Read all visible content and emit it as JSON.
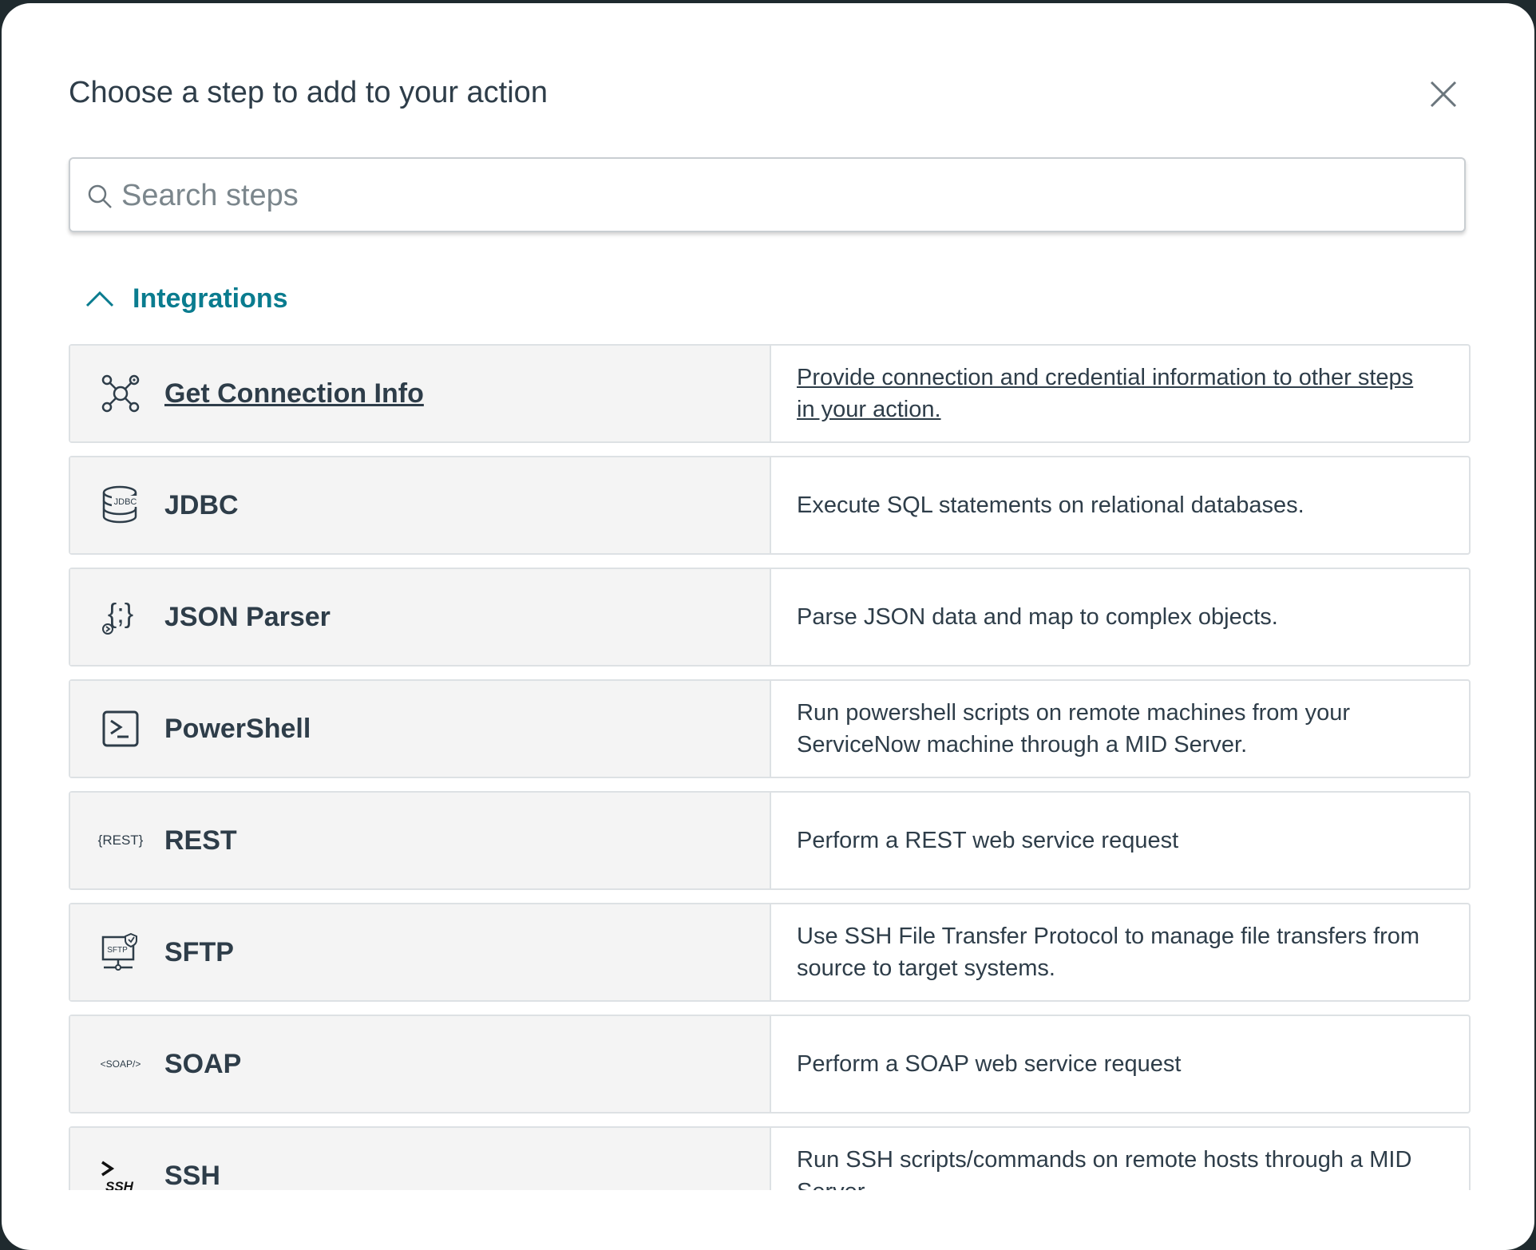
{
  "dialog": {
    "title": "Choose a step to add to your action",
    "close_icon": "close-icon"
  },
  "search": {
    "placeholder": "Search steps",
    "value": "",
    "icon": "search-icon"
  },
  "section": {
    "title": "Integrations",
    "icon": "chevron-up-icon",
    "expanded": true
  },
  "steps": [
    {
      "name": "Get Connection Info",
      "icon": "network-nodes-icon",
      "description": "Provide connection and credential information to other steps in your action.",
      "hovered": true
    },
    {
      "name": "JDBC",
      "icon": "database-jdbc-icon",
      "icon_text": "JDBC",
      "description": "Execute SQL statements on relational databases."
    },
    {
      "name": "JSON Parser",
      "icon": "json-parser-icon",
      "icon_text": "{;}",
      "description": "Parse JSON data and map to complex objects."
    },
    {
      "name": "PowerShell",
      "icon": "powershell-icon",
      "description": "Run powershell scripts on remote machines from your ServiceNow machine through a MID Server."
    },
    {
      "name": "REST",
      "icon": "rest-icon",
      "icon_text": "{REST}",
      "description": "Perform a REST web service request"
    },
    {
      "name": "SFTP",
      "icon": "sftp-icon",
      "icon_text": "SFTP",
      "description": "Use SSH File Transfer Protocol to manage file transfers from source to target systems."
    },
    {
      "name": "SOAP",
      "icon": "soap-icon",
      "icon_text": "<SOAP/>",
      "description": "Perform a SOAP web service request"
    },
    {
      "name": "SSH",
      "icon": "ssh-icon",
      "icon_text": "SSH",
      "description": "Run SSH scripts/commands on remote hosts through a MID Server."
    }
  ],
  "colors": {
    "accent": "#0a7c8f",
    "text": "#2e3d49",
    "row_left_bg": "#f4f4f4",
    "border": "#dde1e4"
  }
}
